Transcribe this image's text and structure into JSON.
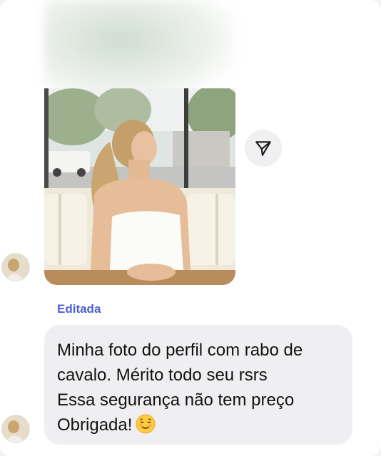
{
  "message": {
    "edited_label": "Editada",
    "lines": [
      "Minha foto do perfil com rabo de",
      "cavalo. Mérito todo seu rsrs",
      "Essa segurança não tem preço",
      "Obrigada!"
    ],
    "emoji": "relieved-face"
  },
  "share": {
    "icon": "send-arrow-icon"
  },
  "colors": {
    "edited_label": "#4d5fd6",
    "bubble": "#efeff1",
    "text": "#121212"
  }
}
